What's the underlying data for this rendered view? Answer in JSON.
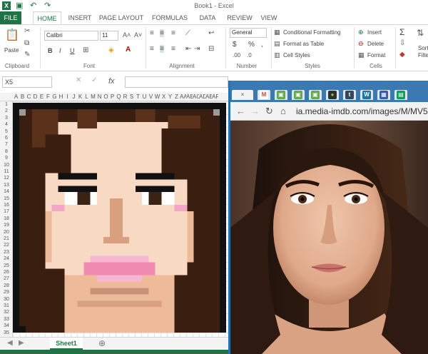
{
  "window": {
    "title": "Book1 - Excel"
  },
  "ribbon_tabs": [
    "FILE",
    "HOME",
    "INSERT",
    "PAGE LAYOUT",
    "FORMULAS",
    "DATA",
    "REVIEW",
    "VIEW"
  ],
  "clipboard": {
    "paste_label": "Paste",
    "group_label": "Clipboard"
  },
  "font": {
    "name": "Calibri",
    "size": "11",
    "bold": "B",
    "italic": "I",
    "underline": "U",
    "group_label": "Font"
  },
  "alignment": {
    "group_label": "Alignment"
  },
  "number": {
    "format": "General",
    "currency": "$",
    "percent": "%",
    "comma": ",",
    "group_label": "Number"
  },
  "styles": {
    "conditional": "Conditional Formatting",
    "table": "Format as Table",
    "cell": "Cell Styles",
    "group_label": "Styles"
  },
  "cells": {
    "insert": "Insert",
    "delete": "Delete",
    "format": "Format",
    "group_label": "Cells"
  },
  "editing": {
    "sum": "Σ",
    "sort": "Sort",
    "filter": "Filte"
  },
  "formula_bar": {
    "name_box": "X5",
    "fx": "fx"
  },
  "columns": [
    "A",
    "B",
    "C",
    "D",
    "E",
    "F",
    "G",
    "H",
    "I",
    "J",
    "K",
    "L",
    "M",
    "N",
    "O",
    "P",
    "Q",
    "R",
    "S",
    "T",
    "U",
    "V",
    "W",
    "X",
    "Y",
    "Z",
    "AA",
    "AB",
    "AC",
    "AD",
    "AE",
    "AF"
  ],
  "rows": [
    "1",
    "2",
    "3",
    "4",
    "5",
    "6",
    "7",
    "8",
    "9",
    "10",
    "11",
    "12",
    "13",
    "14",
    "15",
    "16",
    "17",
    "18",
    "19",
    "20",
    "21",
    "22",
    "23",
    "24",
    "25",
    "26",
    "27",
    "28",
    "29",
    "30",
    "31",
    "32",
    "33",
    "34",
    "35"
  ],
  "sheet_tab": "Sheet1",
  "browser": {
    "url": "ia.media-imdb.com/images/M/MV5",
    "tab_close": "×"
  },
  "colors": {
    "excel_green": "#217346",
    "browser_blue": "#3b79b2",
    "hair": "#3a1e10",
    "skin": "#f5d0b5",
    "lips": "#f08ab0"
  }
}
